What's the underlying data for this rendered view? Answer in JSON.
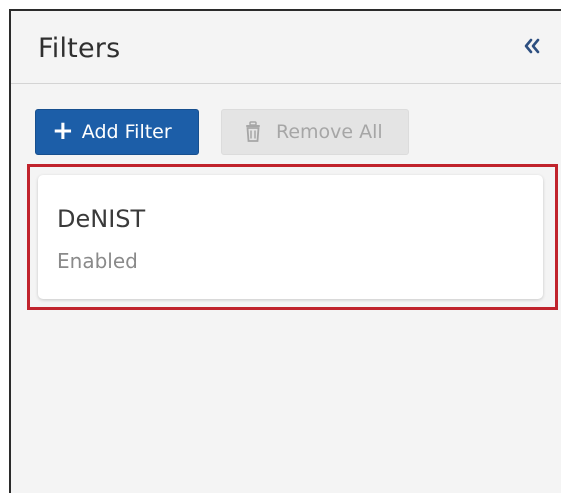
{
  "panel": {
    "title": "Filters",
    "collapse_icon": "double-chevron-left-icon"
  },
  "toolbar": {
    "add_filter_label": "Add Filter",
    "add_filter_icon": "plus-icon",
    "remove_all_label": "Remove All",
    "remove_all_icon": "trash-icon",
    "remove_all_disabled": true
  },
  "filters": [
    {
      "name": "DeNIST",
      "status": "Enabled",
      "highlighted": true
    }
  ],
  "colors": {
    "primary": "#1c5ea8",
    "highlight": "#c0232c",
    "disabled_bg": "#e4e4e4",
    "disabled_text": "#a6a6a6"
  }
}
